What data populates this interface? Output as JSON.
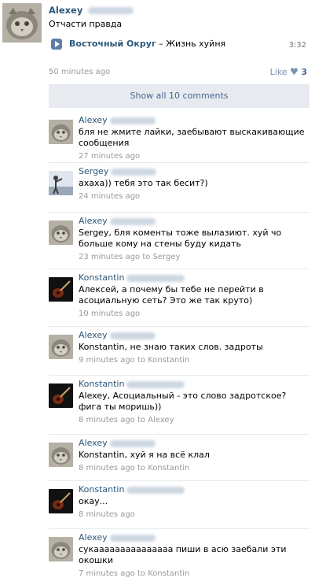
{
  "post": {
    "author": "Alexey",
    "text": "Отчасти правда",
    "audio": {
      "artist": "Восточный Округ",
      "separator": " – ",
      "title": "Жизнь хуйня",
      "duration": "3:32"
    },
    "time": "50 minutes ago",
    "like_label": "Like",
    "like_count": "3"
  },
  "show_all_label": "Show all 10 comments",
  "comments": [
    {
      "author": "Alexey",
      "text": "бля не жмите лайки, заебывают выскакивающие сообщения",
      "time": "27 minutes ago",
      "reply_to": "",
      "avatar": "cat"
    },
    {
      "author": "Sergey",
      "text": "ахаха)) тебя это так бесит?)",
      "time": "24 minutes ago",
      "reply_to": "",
      "avatar": "person"
    },
    {
      "author": "Alexey",
      "text": "Sergey, бля коменты тоже вылазиют. хуй чо больше кому на стены буду кидать",
      "time": "23 minutes ago",
      "reply_to": "Sergey",
      "avatar": "cat"
    },
    {
      "author": "Konstantin",
      "text": "Алексей, а почему бы тебе не перейти в асоциальную сеть? Это же так круто)",
      "time": "10 minutes ago",
      "reply_to": "",
      "avatar": "guitar"
    },
    {
      "author": "Alexey",
      "text": "Konstantin, не знаю таких слов. задроты",
      "time": "9 minutes ago",
      "reply_to": "Konstantin",
      "avatar": "cat"
    },
    {
      "author": "Konstantin",
      "text": "Alexey, Асоциальный - это слово задротское? фига ты моришь))",
      "time": "8 minutes ago",
      "reply_to": "Alexey",
      "avatar": "guitar"
    },
    {
      "author": "Alexey",
      "text": "Konstantin, хуй я на всё клал",
      "time": "8 minutes ago",
      "reply_to": "Konstantin",
      "avatar": "cat"
    },
    {
      "author": "Konstantin",
      "text": "окау...",
      "time": "8 minutes ago",
      "reply_to": "",
      "avatar": "guitar"
    },
    {
      "author": "Alexey",
      "text": "сукааааааааааааааа пиши в асю заебали эти окошки",
      "time": "7 minutes ago",
      "reply_to": "Konstantin",
      "avatar": "cat"
    }
  ],
  "to_word": "to",
  "colors": {
    "link": "#2b587a",
    "meta": "#999999",
    "show_all_bg": "#e7ebf0",
    "divider": "#e6e9ed"
  }
}
